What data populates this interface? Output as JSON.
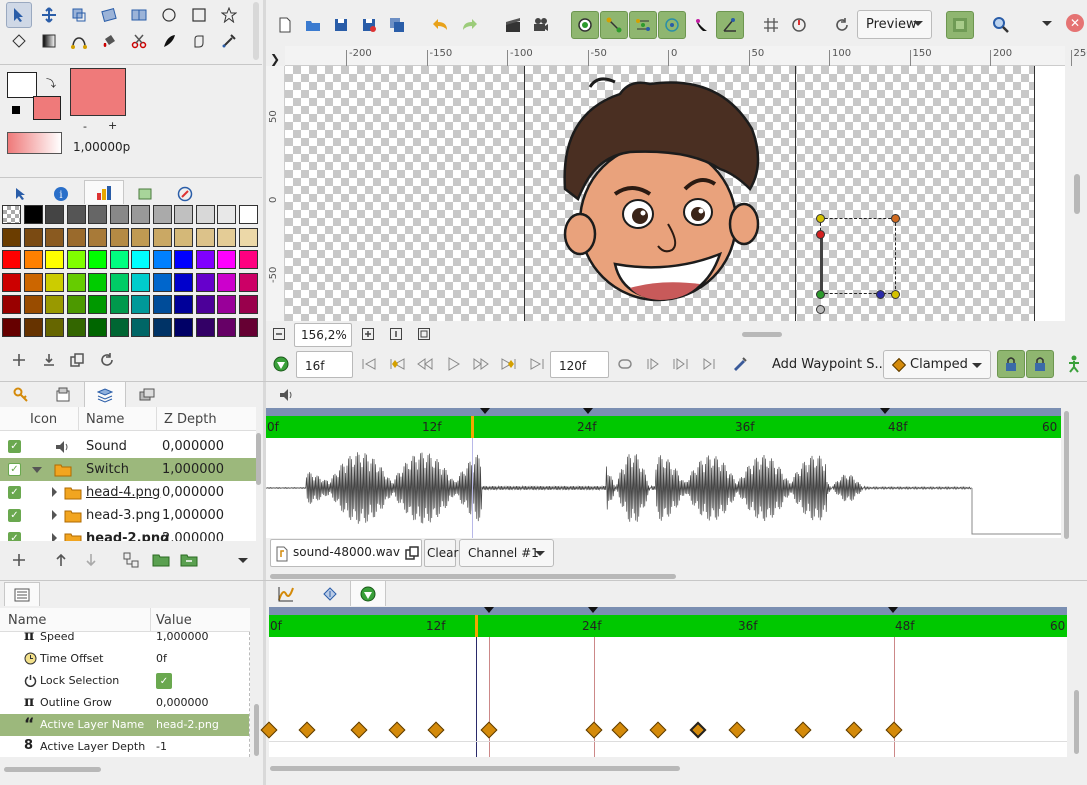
{
  "toolbox": {
    "fill_width": "1,00000p",
    "minus": "-",
    "plus": "+"
  },
  "toolbar": {
    "render_mode": "Preview"
  },
  "canvas": {
    "ruler_x": [
      "-200",
      "-150",
      "-100",
      "-50",
      "0",
      "50",
      "100",
      "150",
      "200",
      "250"
    ],
    "ruler_y": [
      "50",
      "0",
      "-50"
    ],
    "zoom": "156,2%"
  },
  "frames": {
    "current_frame": "16f",
    "end_frame": "120f",
    "add_waypoint": "Add Waypoint S...",
    "interpolation": "Clamped"
  },
  "layers": {
    "columns": {
      "icon": "Icon",
      "name": "Name",
      "zdepth": "Z Depth"
    },
    "rows": [
      {
        "name": "Sound",
        "z": "0,000000"
      },
      {
        "name": "Switch",
        "z": "1,000000"
      },
      {
        "name": "head-4.png",
        "z": "0,000000"
      },
      {
        "name": "head-3.png",
        "z": "1,000000"
      },
      {
        "name": "head-2.png",
        "z": "2,000000"
      }
    ]
  },
  "sound": {
    "timeline_labels": [
      "0f",
      "12f",
      "24f",
      "36f",
      "48f",
      "60"
    ],
    "file": "sound-48000.wav",
    "clear": "Clear",
    "channel": "Channel #1"
  },
  "params": {
    "columns": {
      "name": "Name",
      "value": "Value"
    },
    "rows": [
      {
        "name": "Speed",
        "value": "1,000000"
      },
      {
        "name": "Time Offset",
        "value": "0f"
      },
      {
        "name": "Lock Selection",
        "value": ""
      },
      {
        "name": "Outline Grow",
        "value": "0,000000"
      },
      {
        "name": "Active Layer Name",
        "value": "head-2.png"
      },
      {
        "name": "Active Layer Depth",
        "value": "-1"
      }
    ]
  },
  "timetrack": {
    "labels": [
      "0f",
      "12f",
      "24f",
      "36f",
      "48f",
      "60"
    ]
  },
  "colors": {
    "selection": "#9cb87c",
    "timeline_green": "#00c800",
    "timeline_blue": "#7b8fb2"
  }
}
